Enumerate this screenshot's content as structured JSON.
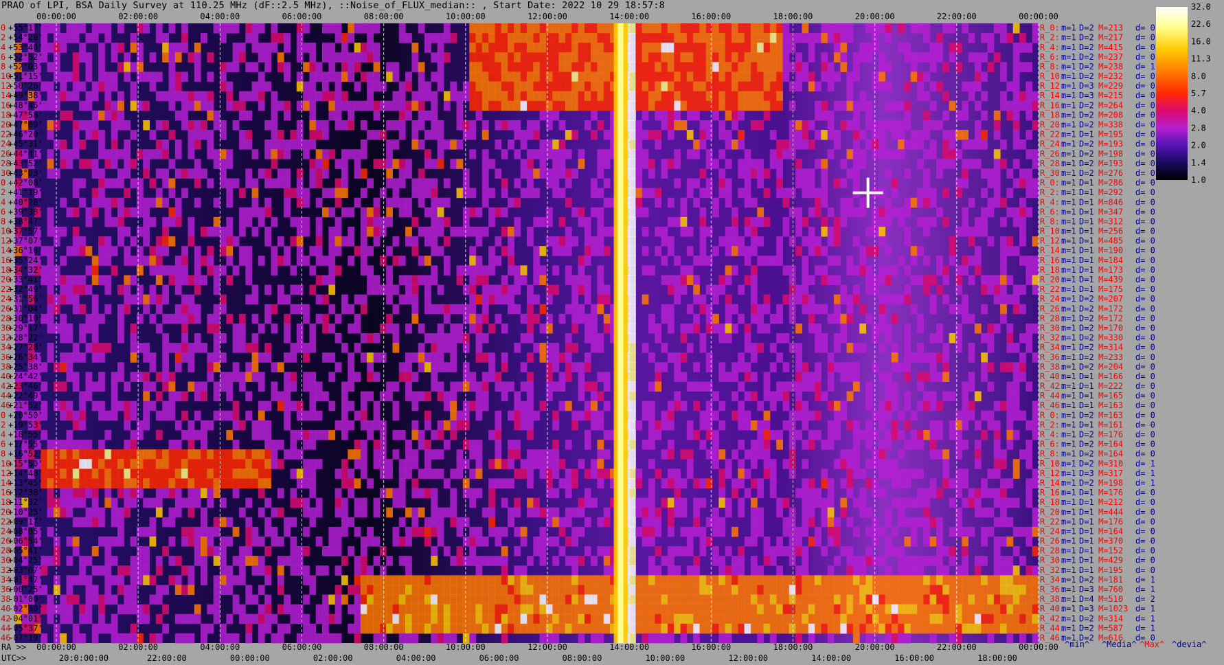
{
  "title": "PRAO of LPI, BSA Daily Survey at 110.25 MHz (dF::2.5 MHz), ::Noise_of_FLUX_median:: , Start Date: 2022 10 29 18:57:8",
  "colors": {
    "background": "#a6a6a6",
    "colormap": [
      "#000000",
      "#1a0a5e",
      "#5514b4",
      "#b420d2",
      "#dc0a6e",
      "#ff2800",
      "#ff7800",
      "#ffc800",
      "#ffff8c",
      "#ffffff"
    ],
    "min_label": "#0000aa",
    "median_label": "#000080",
    "max_label": "#ff0000",
    "dev_label": "#000080"
  },
  "chart_data": {
    "type": "heatmap",
    "title": "PRAO of LPI, BSA Daily Survey at 110.25 MHz (dF::2.5 MHz), ::Noise_of_FLUX_median:: , Start Date: 2022 10 29 18:57:8",
    "x_top_ticks": [
      "00:00:00",
      "02:00:00",
      "04:00:00",
      "06:00:00",
      "08:00:00",
      "10:00:00",
      "12:00:00",
      "14:00:00",
      "16:00:00",
      "18:00:00",
      "20:00:00",
      "22:00:00",
      "00:00:00"
    ],
    "x_bottom_ra_label": "RA >>",
    "x_bottom_ra_ticks": [
      "00:00:00",
      "02:00:00",
      "04:00:00",
      "06:00:00",
      "08:00:00",
      "10:00:00",
      "12:00:00",
      "14:00:00",
      "16:00:00",
      "18:00:00",
      "20:00:00",
      "22:00:00",
      "00:00:00"
    ],
    "x_bottom_utc_label": "UTC>>",
    "x_bottom_utc_ticks": [
      "20:0:00:00",
      "22:00:00",
      "00:00:00",
      "02:00:00",
      "04:00:00",
      "06:00:00",
      "08:00:00",
      "10:00:00",
      "12:00:00",
      "14:00:00",
      "16:00:00",
      "18:00:00"
    ],
    "y_ticks": [
      "+55°17'",
      "+54°29'",
      "+53°40'",
      "+52°52'",
      "+52°03'",
      "+51°15'",
      "+50°26'",
      "+49°38'",
      "+48°46'",
      "+47°58'",
      "+47°09'",
      "+46°20'",
      "+45°31'",
      "+44°41'",
      "+43°52'",
      "+43°03'",
      "+42°08'",
      "+41°19'",
      "+40°28'",
      "+39°38'",
      "+38°47'",
      "+37°57'",
      "+37°07'",
      "+36°16'",
      "+35°24'",
      "+34°32'",
      "+33°41'",
      "+32°49'",
      "+31°56'",
      "+31°04'",
      "+30°10'",
      "+29°17'",
      "+28°22'",
      "+27°28'",
      "+26°34'",
      "+25°38'",
      "+24°42'",
      "+23°46'",
      "+22°49'",
      "+21°52'",
      "+20°50'",
      "+19°53'",
      "+18°55'",
      "+17°55'",
      "+16°52'",
      "+15°50'",
      "+14°48'",
      "+13°45'",
      "+12°38'",
      "+11°32'",
      "+10°25'",
      "+09°17'",
      "+08°05'",
      "+06°54'",
      "+05°41'",
      "+04°25'",
      "+03°07'",
      "+01°47'",
      "+00°25'",
      "-01°00'",
      "-02°30'",
      "-04°01'",
      "-05°37'",
      "-07°19'"
    ],
    "row_index_labels": [
      "0",
      "2",
      "4",
      "6",
      "8",
      "10",
      "12",
      "14",
      "16",
      "18",
      "20",
      "22",
      "24",
      "26",
      "28",
      "30",
      "0",
      "2",
      "4",
      "6",
      "8",
      "10",
      "12",
      "14",
      "16",
      "18",
      "20",
      "22",
      "24",
      "26",
      "28",
      "30",
      "32",
      "34",
      "36",
      "38",
      "40",
      "42",
      "44",
      "46",
      "0",
      "2",
      "4",
      "6",
      "8",
      "10",
      "12",
      "14",
      "16",
      "18",
      "20",
      "22",
      "24",
      "26",
      "28",
      "30",
      "32",
      "34",
      "36",
      "38",
      "40",
      "42",
      "44",
      "46"
    ],
    "colorbar": {
      "scale": "log",
      "range": [
        1.0,
        32.0
      ],
      "ticks": [
        "32.0",
        "22.6",
        "16.0",
        "11.3",
        "8.0",
        "5.7",
        "4.0",
        "2.8",
        "2.0",
        "1.4",
        "1.0"
      ]
    },
    "row_stats": [
      [
        "R_0:",
        "m=1",
        "D=2",
        "M=213",
        "d= 0"
      ],
      [
        "R_2:",
        "m=1",
        "D=2",
        "M=217",
        "d= 0"
      ],
      [
        "R_4:",
        "m=1",
        "D=2",
        "M=415",
        "d= 0"
      ],
      [
        "R_6:",
        "m=1",
        "D=2",
        "M=237",
        "d= 0"
      ],
      [
        "R_8:",
        "m=1",
        "D=2",
        "M=238",
        "d= 1"
      ],
      [
        "R_10:",
        "m=1",
        "D=2",
        "M=232",
        "d= 0"
      ],
      [
        "R_12:",
        "m=1",
        "D=3",
        "M=229",
        "d= 0"
      ],
      [
        "R_14:",
        "m=1",
        "D=3",
        "M=215",
        "d= 0"
      ],
      [
        "R_16:",
        "m=1",
        "D=2",
        "M=264",
        "d= 0"
      ],
      [
        "R_18:",
        "m=1",
        "D=2",
        "M=208",
        "d= 0"
      ],
      [
        "R_20:",
        "m=1",
        "D=2",
        "M=338",
        "d= 0"
      ],
      [
        "R_22:",
        "m=1",
        "D=1",
        "M=195",
        "d= 0"
      ],
      [
        "R_24:",
        "m=1",
        "D=2",
        "M=193",
        "d= 0"
      ],
      [
        "R_26:",
        "m=1",
        "D=2",
        "M=198",
        "d= 0"
      ],
      [
        "R_28:",
        "m=1",
        "D=2",
        "M=193",
        "d= 0"
      ],
      [
        "R_30:",
        "m=1",
        "D=2",
        "M=276",
        "d= 0"
      ],
      [
        "R_0:",
        "m=1",
        "D=1",
        "M=286",
        "d= 0"
      ],
      [
        "R_2:",
        "m=1",
        "D=1",
        "M=292",
        "d= 0"
      ],
      [
        "R_4:",
        "m=1",
        "D=1",
        "M=846",
        "d= 0"
      ],
      [
        "R_6:",
        "m=1",
        "D=1",
        "M=347",
        "d= 0"
      ],
      [
        "R_8:",
        "m=1",
        "D=1",
        "M=312",
        "d= 0"
      ],
      [
        "R_10:",
        "m=1",
        "D=1",
        "M=256",
        "d= 0"
      ],
      [
        "R_12:",
        "m=1",
        "D=1",
        "M=485",
        "d= 0"
      ],
      [
        "R_14:",
        "m=1",
        "D=1",
        "M=190",
        "d= 0"
      ],
      [
        "R_16:",
        "m=1",
        "D=1",
        "M=184",
        "d= 0"
      ],
      [
        "R_18:",
        "m=1",
        "D=1",
        "M=173",
        "d= 0"
      ],
      [
        "R_20:",
        "m=1",
        "D=1",
        "M=439",
        "d= 0"
      ],
      [
        "R_22:",
        "m=1",
        "D=1",
        "M=175",
        "d= 0"
      ],
      [
        "R_24:",
        "m=1",
        "D=2",
        "M=207",
        "d= 0"
      ],
      [
        "R_26:",
        "m=1",
        "D=2",
        "M=172",
        "d= 0"
      ],
      [
        "R_28:",
        "m=1",
        "D=2",
        "M=172",
        "d= 0"
      ],
      [
        "R_30:",
        "m=1",
        "D=2",
        "M=170",
        "d= 0"
      ],
      [
        "R_32:",
        "m=1",
        "D=2",
        "M=330",
        "d= 0"
      ],
      [
        "R_34:",
        "m=1",
        "D=2",
        "M=314",
        "d= 0"
      ],
      [
        "R_36:",
        "m=1",
        "D=2",
        "M=233",
        "d= 0"
      ],
      [
        "R_38:",
        "m=1",
        "D=2",
        "M=204",
        "d= 0"
      ],
      [
        "R_40:",
        "m=1",
        "D=1",
        "M=166",
        "d= 0"
      ],
      [
        "R_42:",
        "m=1",
        "D=1",
        "M=222",
        "d= 0"
      ],
      [
        "R_44:",
        "m=1",
        "D=1",
        "M=165",
        "d= 0"
      ],
      [
        "R_46:",
        "m=1",
        "D=1",
        "M=163",
        "d= 0"
      ],
      [
        "R_0:",
        "m=1",
        "D=2",
        "M=163",
        "d= 0"
      ],
      [
        "R_2:",
        "m=1",
        "D=1",
        "M=161",
        "d= 0"
      ],
      [
        "R_4:",
        "m=1",
        "D=2",
        "M=176",
        "d= 0"
      ],
      [
        "R_6:",
        "m=1",
        "D=2",
        "M=164",
        "d= 0"
      ],
      [
        "R_8:",
        "m=1",
        "D=2",
        "M=164",
        "d= 0"
      ],
      [
        "R_10:",
        "m=1",
        "D=2",
        "M=310",
        "d= 1"
      ],
      [
        "R_12:",
        "m=1",
        "D=3",
        "M=317",
        "d= 1"
      ],
      [
        "R_14:",
        "m=1",
        "D=2",
        "M=198",
        "d= 1"
      ],
      [
        "R_16:",
        "m=1",
        "D=1",
        "M=176",
        "d= 0"
      ],
      [
        "R_18:",
        "m=1",
        "D=1",
        "M=212",
        "d= 0"
      ],
      [
        "R_20:",
        "m=1",
        "D=1",
        "M=444",
        "d= 0"
      ],
      [
        "R_22:",
        "m=1",
        "D=1",
        "M=176",
        "d= 0"
      ],
      [
        "R_24:",
        "m=1",
        "D=1",
        "M=164",
        "d= 0"
      ],
      [
        "R_26:",
        "m=1",
        "D=1",
        "M=370",
        "d= 0"
      ],
      [
        "R_28:",
        "m=1",
        "D=1",
        "M=152",
        "d= 0"
      ],
      [
        "R_30:",
        "m=1",
        "D=1",
        "M=429",
        "d= 0"
      ],
      [
        "R_32:",
        "m=1",
        "D=1",
        "M=195",
        "d= 0"
      ],
      [
        "R_34:",
        "m=1",
        "D=2",
        "M=181",
        "d= 1"
      ],
      [
        "R_36:",
        "m=1",
        "D=3",
        "M=760",
        "d= 1"
      ],
      [
        "R_38:",
        "m=1",
        "D=4",
        "M=510",
        "d= 2"
      ],
      [
        "R_40:",
        "m=1",
        "D=3",
        "M=1023",
        "d= 1"
      ],
      [
        "R_42:",
        "m=1",
        "D=2",
        "M=314",
        "d= 1"
      ],
      [
        "R_44:",
        "m=1",
        "D=2",
        "M=587",
        "d= 1"
      ],
      [
        "R_46:",
        "m=1",
        "D=2",
        "M=616",
        "d= 0"
      ]
    ],
    "stats_legend": [
      "^min^",
      "^Media^",
      "^Max^",
      "^devia^"
    ],
    "features": [
      {
        "label": "",
        "x_hours": 14.2,
        "kind": "vertical_band",
        "intensity": 32.0
      },
      {
        "label": "",
        "x_hours": 20.0,
        "dec": "+41°19'",
        "kind": "point_source",
        "intensity": 32.0
      },
      {
        "label": "",
        "x_range_hours": [
          8.0,
          24.0
        ],
        "dec_range": [
          "+00°25'",
          "-02°30'"
        ],
        "kind": "horizontal_band",
        "intensity": 16.0
      }
    ]
  }
}
